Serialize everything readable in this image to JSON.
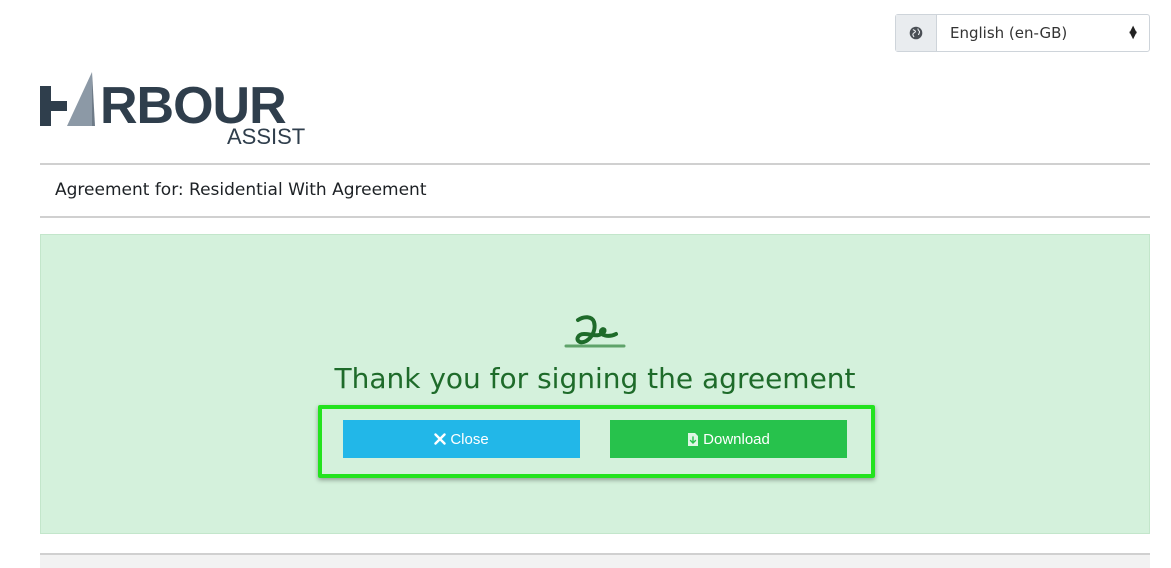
{
  "language": {
    "icon": "globe-icon",
    "selected": "English (en-GB)"
  },
  "logo": {
    "word": "HARBOUR",
    "sub": "ASSIST",
    "color": "#2f3e4c",
    "sail_color": "#8c99a6"
  },
  "agreement": {
    "title": "Agreement for: Residential With Agreement"
  },
  "success": {
    "icon": "signature-icon",
    "message": "Thank you for signing the agreement",
    "background": "#d4f1dc",
    "text_color": "#1e6b2a"
  },
  "actions": {
    "close_label": "Close",
    "close_icon": "close-icon",
    "close_color": "#22b7e8",
    "download_label": "Download",
    "download_icon": "download-file-icon",
    "download_color": "#27c24c",
    "highlight_color": "#22e31e"
  }
}
